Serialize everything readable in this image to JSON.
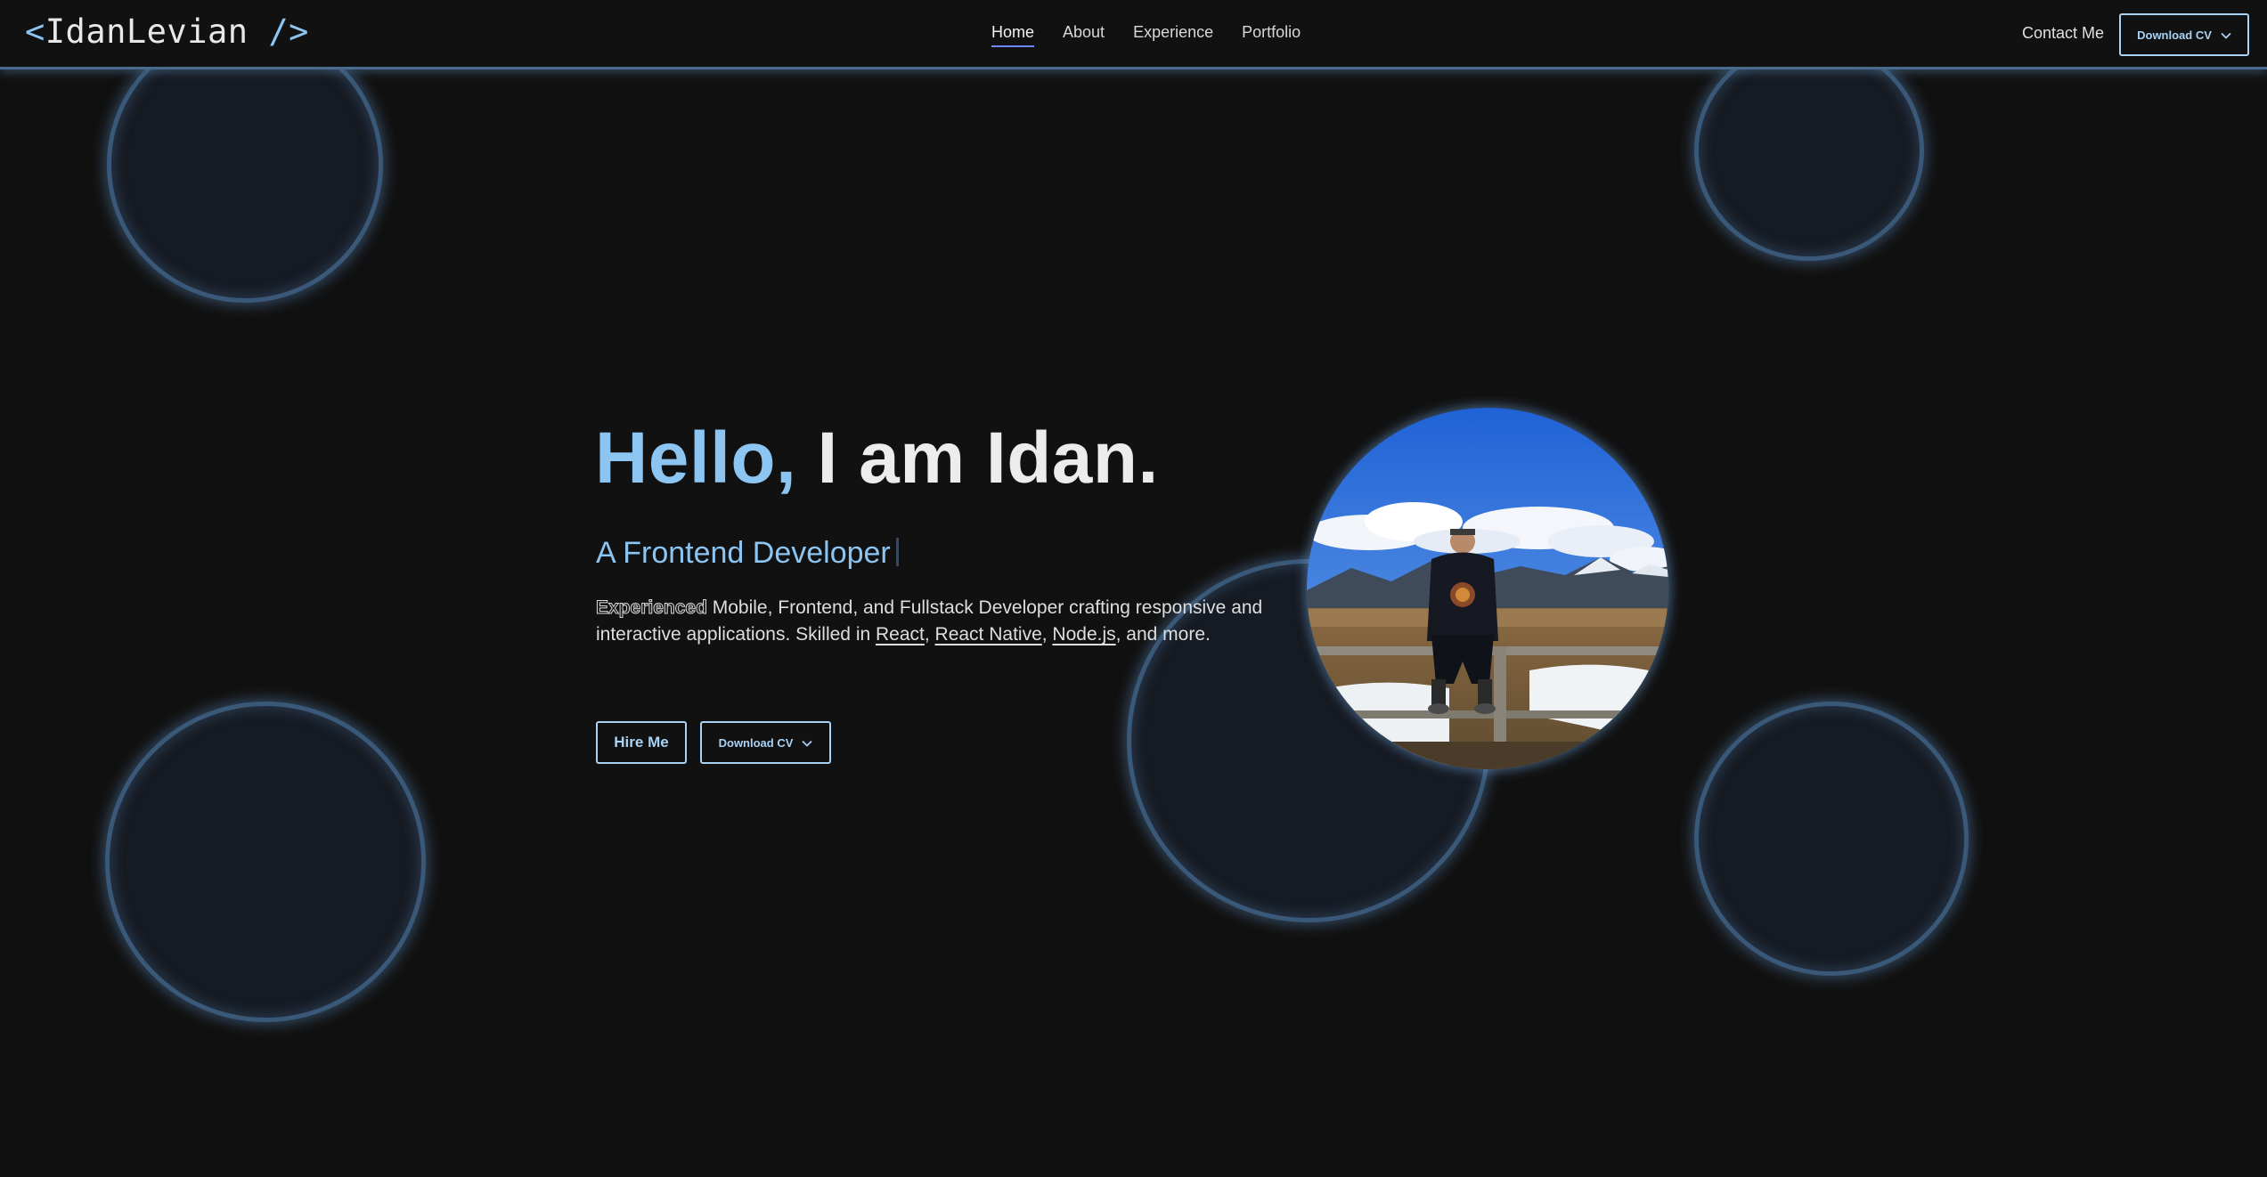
{
  "logo": {
    "open": "<",
    "name": "IdanLevian",
    "close": " />"
  },
  "nav": {
    "links": [
      {
        "label": "Home",
        "active": true
      },
      {
        "label": "About",
        "active": false
      },
      {
        "label": "Experience",
        "active": false
      },
      {
        "label": "Portfolio",
        "active": false
      }
    ],
    "contact_label": "Contact Me",
    "download_cv_label": "Download CV"
  },
  "hero": {
    "greeting_accent": "Hello,",
    "greeting_rest": " I am Idan.",
    "role": "A Frontend Developer",
    "bio": {
      "strong": "Experienced",
      "part1": " Mobile, Frontend, and Fullstack Developer crafting responsive and interactive applications. Skilled in ",
      "skills": [
        "React",
        "React Native",
        "Node.js"
      ],
      "sep1": ", ",
      "sep2": ", ",
      "end": ", and more."
    },
    "hire_label": "Hire Me",
    "download_cv_label": "Download CV"
  },
  "colors": {
    "background": "#111111",
    "accent": "#8cc4f2",
    "bubble_border": "#3a5878",
    "nav_active_underline": "#6f87ff"
  },
  "icons": {
    "dropdown": "chevron-down-icon"
  }
}
